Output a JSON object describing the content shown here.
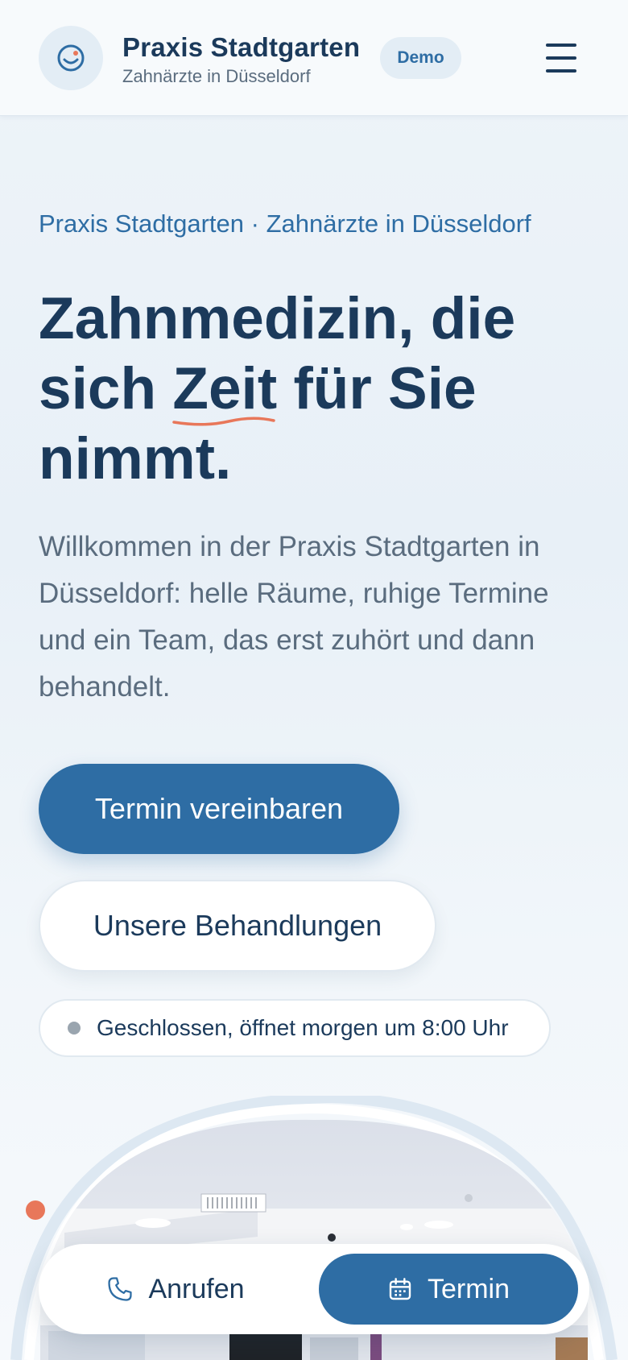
{
  "header": {
    "brand_name": "Praxis Stadtgarten",
    "brand_subtitle": "Zahnärzte in Düsseldorf",
    "badge": "Demo",
    "logo_icon": "smile-icon",
    "menu_icon": "hamburger-menu-icon"
  },
  "hero": {
    "eyebrow": "Praxis Stadtgarten · Zahnärzte in Düsseldorf",
    "headline": {
      "line1": "Zahnmedizin, die",
      "line2_before": "sich ",
      "line2_highlight": "Zeit",
      "line2_after": " für Sie",
      "line3": "nimmt."
    },
    "intro_lines": [
      "Willkommen in der Praxis Stadtgarten in",
      "Düsseldorf: helle Räume, ruhige Termine",
      "und ein Team, das erst zuhört und dann",
      "behandelt."
    ],
    "primary_button": "Termin vereinbaren",
    "secondary_button": "Unsere Behandlungen",
    "status": "Geschlossen, öffnet morgen um 8:00 Uhr"
  },
  "bottom_bar": {
    "call_label": "Anrufen",
    "call_icon": "phone-icon",
    "appointment_label": "Termin",
    "appointment_icon": "calendar-icon"
  },
  "colors": {
    "primary": "#2e6da4",
    "text_dark": "#1b3a5b",
    "text_muted": "#5a6c7e",
    "accent": "#e8775a",
    "status_closed": "#9aa5af"
  }
}
